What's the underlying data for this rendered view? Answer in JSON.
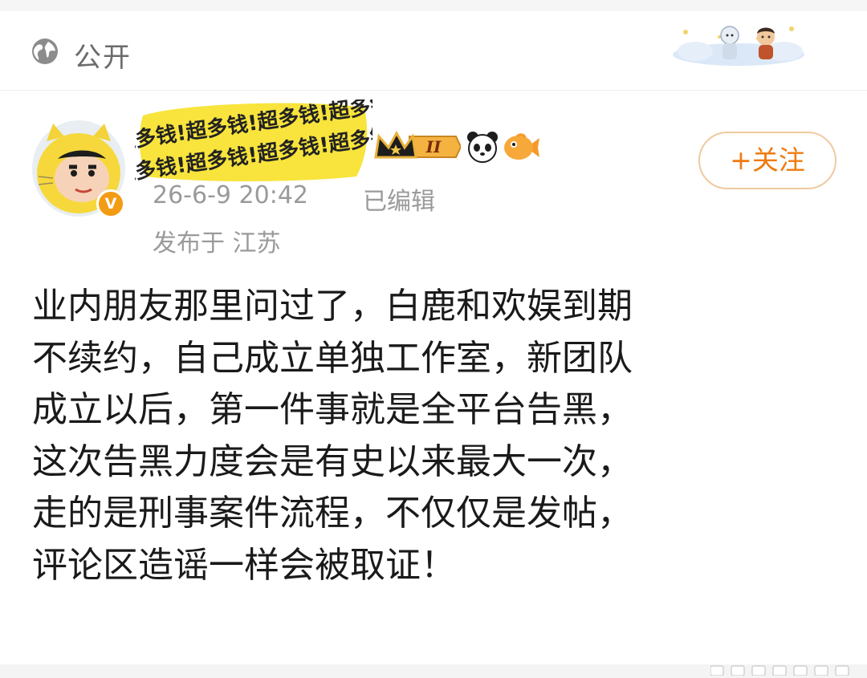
{
  "header": {
    "visibility_label": "公开",
    "icon": "globe-icon"
  },
  "author": {
    "banner_text": "钱!超多钱!超多钱!超多钱!超多钱!超",
    "verified_badge": "V",
    "level_badge": "II",
    "follow_label": "+关注",
    "accent_color": "#ef7b10"
  },
  "post": {
    "timestamp": "26-6-9 20:42",
    "edited_label": "已编辑",
    "location": "发布于 江苏",
    "text": "业内朋友那里问过了，白鹿和欢娱到期\n不续约，自己成立单独工作室，新团队\n成立以后，第一件事就是全平台告黑，\n这次告黑力度会是有史以来最大一次，\n走的是刑事案件流程，不仅仅是发帖，\n评论区造谣一样会被取证！"
  }
}
